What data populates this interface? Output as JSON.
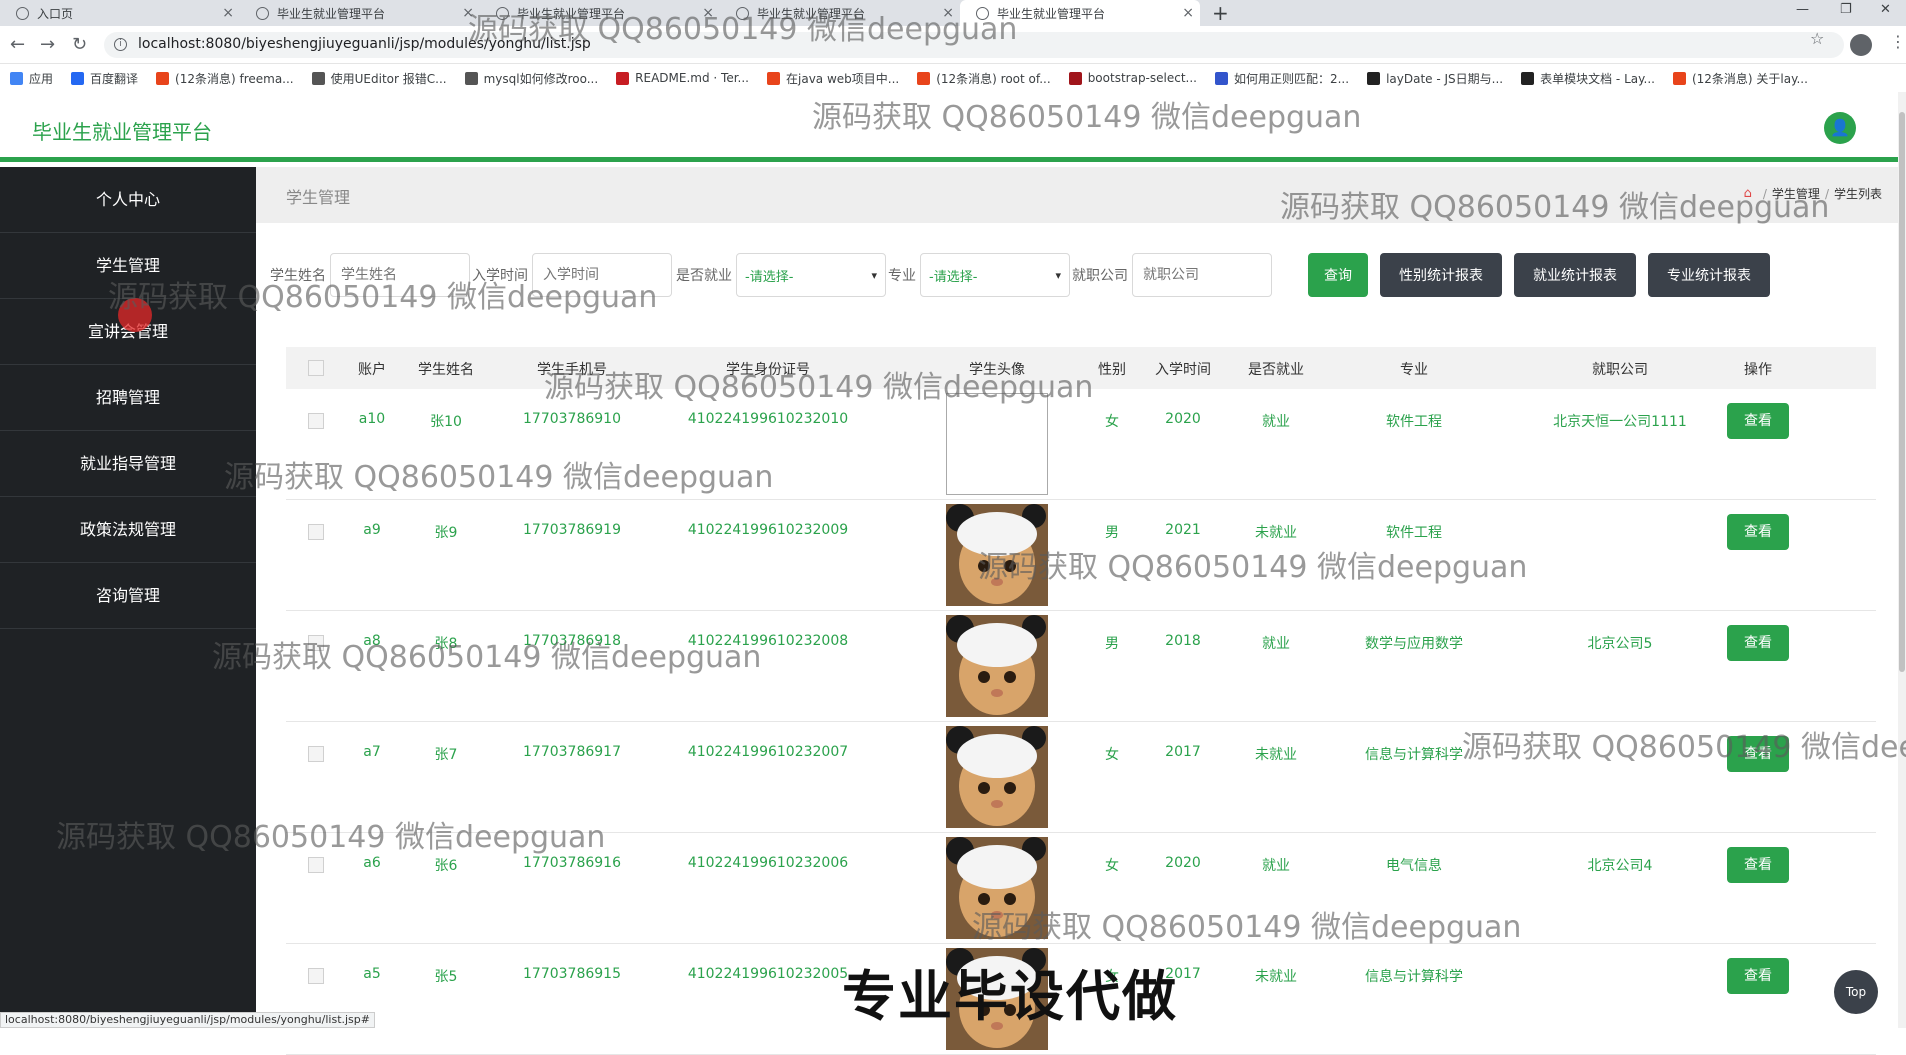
{
  "browser": {
    "tabs": [
      {
        "title": "入口页"
      },
      {
        "title": "毕业生就业管理平台"
      },
      {
        "title": "毕业生就业管理平台"
      },
      {
        "title": "毕业生就业管理平台"
      },
      {
        "title": "毕业生就业管理平台"
      }
    ],
    "url": "localhost:8080/biyeshengjiuyeguanli/jsp/modules/yonghu/list.jsp",
    "status_url": "localhost:8080/biyeshengjiuyeguanli/jsp/modules/yonghu/list.jsp#",
    "bookmarks": [
      {
        "label": "应用",
        "color": "#4285f4"
      },
      {
        "label": "百度翻译",
        "color": "#2468f2"
      },
      {
        "label": "(12条消息) freema...",
        "color": "#e8441b"
      },
      {
        "label": "使用UEditor 报错C...",
        "color": "#555555"
      },
      {
        "label": "mysql如何修改roo...",
        "color": "#555555"
      },
      {
        "label": "README.md · Ter...",
        "color": "#c71d23"
      },
      {
        "label": "在java web项目中...",
        "color": "#e8441b"
      },
      {
        "label": "(12条消息) root of...",
        "color": "#e8441b"
      },
      {
        "label": "bootstrap-select...",
        "color": "#a0151b"
      },
      {
        "label": "如何用正则匹配：2...",
        "color": "#3355cc"
      },
      {
        "label": "layDate - JS日期与...",
        "color": "#222222"
      },
      {
        "label": "表单模块文档 - Lay...",
        "color": "#222222"
      },
      {
        "label": "(12条消息) 关于lay...",
        "color": "#e8441b"
      }
    ]
  },
  "app": {
    "title": "毕业生就业管理平台",
    "accent": "#2ba24c"
  },
  "sidebar": {
    "items": [
      {
        "label": "个人中心"
      },
      {
        "label": "学生管理"
      },
      {
        "label": "宣讲会管理"
      },
      {
        "label": "招聘管理"
      },
      {
        "label": "就业指导管理"
      },
      {
        "label": "政策法规管理"
      },
      {
        "label": "咨询管理"
      }
    ]
  },
  "page": {
    "title": "学生管理",
    "breadcrumb": [
      "学生管理",
      "学生列表"
    ]
  },
  "search": {
    "name_label": "学生姓名",
    "name_placeholder": "学生姓名",
    "time_label": "入学时间",
    "time_placeholder": "入学时间",
    "employed_label": "是否就业",
    "employed_value": "-请选择-",
    "major_label": "专业",
    "major_value": "-请选择-",
    "company_label": "就职公司",
    "company_placeholder": "就职公司",
    "query_btn": "查询",
    "gender_report_btn": "性别统计报表",
    "employment_report_btn": "就业统计报表",
    "major_report_btn": "专业统计报表"
  },
  "table": {
    "columns": [
      "账户",
      "学生姓名",
      "学生手机号",
      "学生身份证号",
      "学生头像",
      "性别",
      "入学时间",
      "是否就业",
      "专业",
      "就职公司",
      "操作"
    ],
    "view_label": "查看",
    "rows": [
      {
        "account": "a10",
        "name": "张10",
        "phone": "17703786910",
        "id": "410224199610232010",
        "gender": "女",
        "year": "2020",
        "employed": "就业",
        "major": "软件工程",
        "company": "北京天恒一公司1111",
        "avatar": "broken"
      },
      {
        "account": "a9",
        "name": "张9",
        "phone": "17703786919",
        "id": "410224199610232009",
        "gender": "男",
        "year": "2021",
        "employed": "未就业",
        "major": "软件工程",
        "company": "",
        "avatar": "cat"
      },
      {
        "account": "a8",
        "name": "张8",
        "phone": "17703786918",
        "id": "410224199610232008",
        "gender": "男",
        "year": "2018",
        "employed": "就业",
        "major": "数学与应用数学",
        "company": "北京公司5",
        "avatar": "cat"
      },
      {
        "account": "a7",
        "name": "张7",
        "phone": "17703786917",
        "id": "410224199610232007",
        "gender": "女",
        "year": "2017",
        "employed": "未就业",
        "major": "信息与计算科学",
        "company": "",
        "avatar": "cat"
      },
      {
        "account": "a6",
        "name": "张6",
        "phone": "17703786916",
        "id": "410224199610232006",
        "gender": "女",
        "year": "2020",
        "employed": "就业",
        "major": "电气信息",
        "company": "北京公司4",
        "avatar": "cat"
      },
      {
        "account": "a5",
        "name": "张5",
        "phone": "17703786915",
        "id": "410224199610232005",
        "gender": "女",
        "year": "2017",
        "employed": "未就业",
        "major": "信息与计算科学",
        "company": "",
        "avatar": "cat"
      }
    ]
  },
  "top_button": "Top",
  "watermark": {
    "text": "源码获取 QQ86050149 微信deepguan",
    "banner": "专业毕设代做"
  }
}
